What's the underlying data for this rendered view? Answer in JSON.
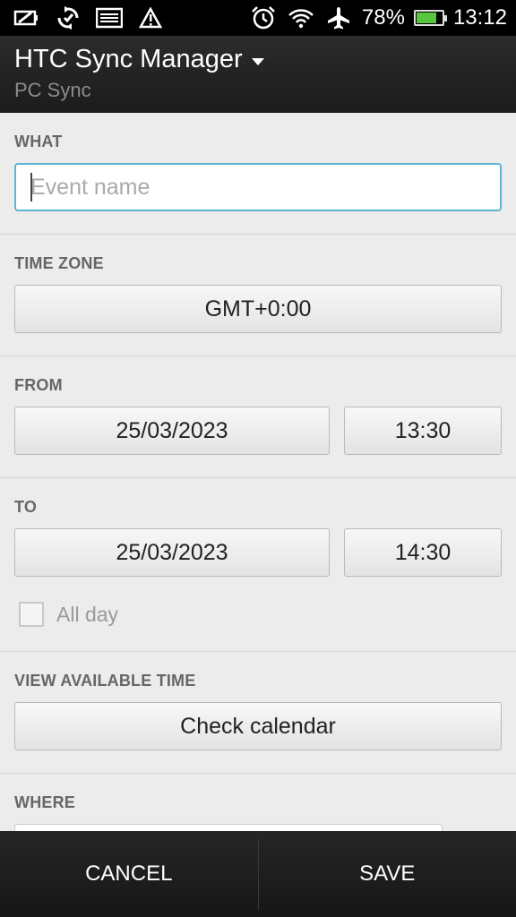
{
  "status_bar": {
    "battery_percent": "78%",
    "battery_level": 0.78,
    "time": "13:12",
    "left_icons": [
      "battery-saver-icon",
      "sync-icon",
      "image-icon",
      "warning-icon"
    ],
    "right_icons": [
      "alarm-icon",
      "wifi-icon",
      "airplane-icon",
      "battery-icon"
    ]
  },
  "action_bar": {
    "title": "HTC Sync Manager",
    "subtitle": "PC Sync"
  },
  "form": {
    "what": {
      "label": "WHAT",
      "placeholder": "Event name",
      "value": ""
    },
    "time_zone": {
      "label": "TIME ZONE",
      "value": "GMT+0:00"
    },
    "from": {
      "label": "FROM",
      "date": "25/03/2023",
      "time": "13:30"
    },
    "to": {
      "label": "TO",
      "date": "25/03/2023",
      "time": "14:30"
    },
    "all_day": {
      "label": "All day",
      "checked": false
    },
    "view_available_time": {
      "label": "VIEW AVAILABLE TIME",
      "button": "Check calendar"
    },
    "where": {
      "label": "WHERE",
      "value": ""
    }
  },
  "bottom_bar": {
    "cancel": "CANCEL",
    "save": "SAVE"
  },
  "colors": {
    "accent": "#5fb4d4",
    "battery_fill": "#58c63f"
  }
}
